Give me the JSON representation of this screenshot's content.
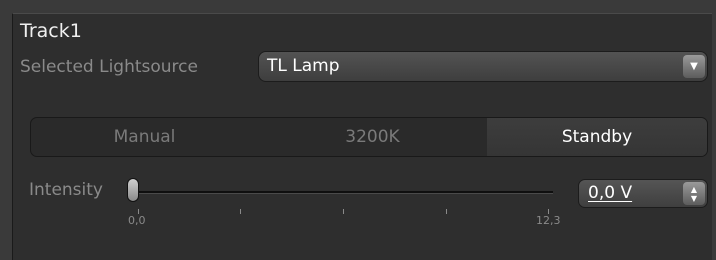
{
  "track": {
    "title": "Track1"
  },
  "lightsource": {
    "label": "Selected Lightsource",
    "value": "TL Lamp",
    "arrow_icon": "chevron-down-icon"
  },
  "modes": {
    "items": [
      {
        "label": "Manual",
        "active": false
      },
      {
        "label": "3200K",
        "active": false
      },
      {
        "label": "Standby",
        "active": true
      }
    ]
  },
  "intensity": {
    "label": "Intensity",
    "min_label": "0,0",
    "max_label": "12,3",
    "value_fraction": 0.0,
    "value_text": "0,0 V"
  }
}
